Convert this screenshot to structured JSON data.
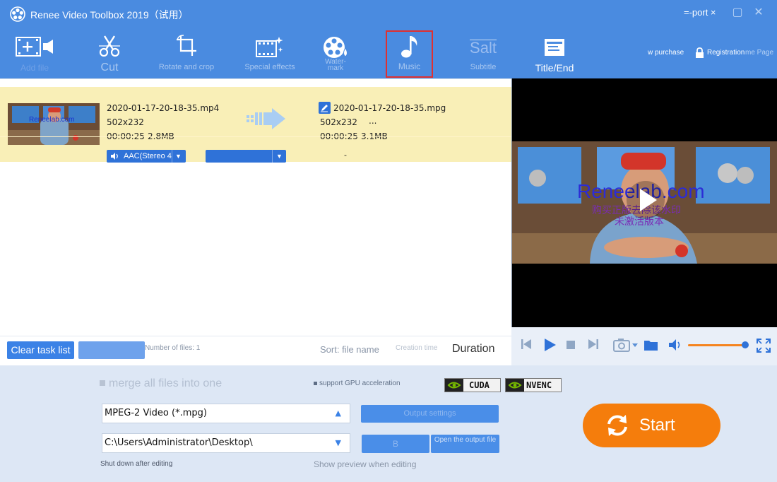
{
  "app": {
    "title": "Renee Video Toolbox 2019（试用）"
  },
  "titlebar": {
    "export_label": "=-port ×"
  },
  "toolbar": {
    "items": [
      {
        "label": "Add file",
        "icon": "add-film-icon"
      },
      {
        "label": "Cut",
        "icon": "scissors-icon"
      },
      {
        "label": "Rotate and crop",
        "icon": "crop-icon"
      },
      {
        "label": "Special effects",
        "icon": "special-effects-icon"
      },
      {
        "label": "Water-\nmark",
        "icon": "watermark-icon"
      },
      {
        "label": "Music",
        "icon": "music-note-icon"
      },
      {
        "label": "Subtitle",
        "icon": "subtitle-icon",
        "glyph": "Salt"
      },
      {
        "label": "Title/End",
        "icon": "title-end-icon"
      }
    ],
    "purchase_label": "w purchase",
    "registration_label": "Registration",
    "home_label": "me Page"
  },
  "task": {
    "source": {
      "filename": "2020-01-17-20-18-35.mp4",
      "resolution": "502x232",
      "duration": "00:00:25",
      "size": "2.8MB"
    },
    "output": {
      "filename": "2020-01-17-20-18-35.mpg",
      "resolution": "502x232",
      "extra": "...",
      "duration": "00:00:25",
      "size": "3.1MB"
    },
    "audio_track": "AAC(Stereo 4",
    "subtitle_value": "-",
    "thumb_watermark": "Reneelab.com"
  },
  "tasklist_footer": {
    "clear_label": "Clear task list",
    "file_count": "Number of files: 1",
    "sort_label": "Sort: file name",
    "creation_label": "Creation time",
    "duration_label": "Duration"
  },
  "preview": {
    "watermark": "Reneelab.com",
    "watermark_cn1": "购买正版去除该水印",
    "watermark_cn2": "未激活版本"
  },
  "settings": {
    "merge_label": "merge all files into one",
    "gpu_label": "support GPU acceleration",
    "gpu_badges": [
      "CUDA",
      "NVENC"
    ],
    "format_value": "MPEG-2 Video (*.mpg)",
    "output_settings_label": "Output settings",
    "folder_value": "C:\\Users\\Administrator\\Desktop\\",
    "browse_label": "B",
    "open_output_label": "Open the output file",
    "shutdown_label": "Shut down after editing",
    "show_preview_label": "Show preview when editing",
    "start_label": "Start"
  },
  "colors": {
    "header_blue": "#4a8be0",
    "accent_blue": "#3b82e6",
    "task_row": "#f9efb7",
    "start_orange": "#f57d0c",
    "selection_red": "#e03030"
  }
}
